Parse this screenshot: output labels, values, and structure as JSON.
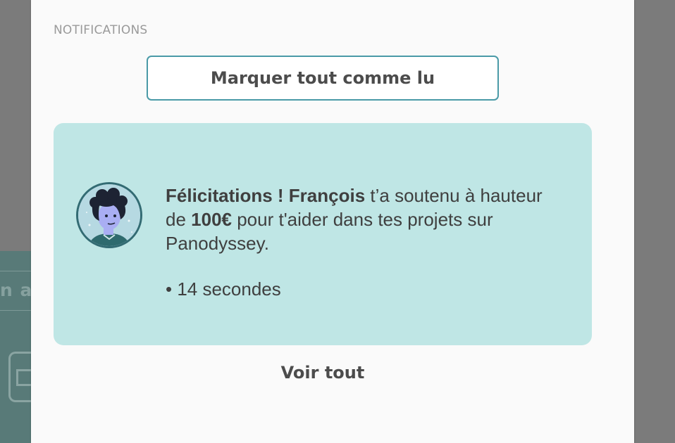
{
  "background": {
    "partial_label": "n a"
  },
  "notifications": {
    "section_title": "NOTIFICATIONS",
    "mark_all_label": "Marquer tout comme lu",
    "items": [
      {
        "avatar_icon": "user-avatar-illustration",
        "title_bold": "Félicitations ! François",
        "text_part1": " t’a soutenu à hauteur de ",
        "amount": "100€",
        "text_part2": " pour t'aider dans tes projets sur Panodyssey.",
        "time": "• 14 secondes"
      }
    ],
    "see_all_label": "Voir tout"
  },
  "colors": {
    "accent": "#4a9aa7",
    "card_background": "#bfe6e5",
    "text": "#3f3f3f"
  }
}
